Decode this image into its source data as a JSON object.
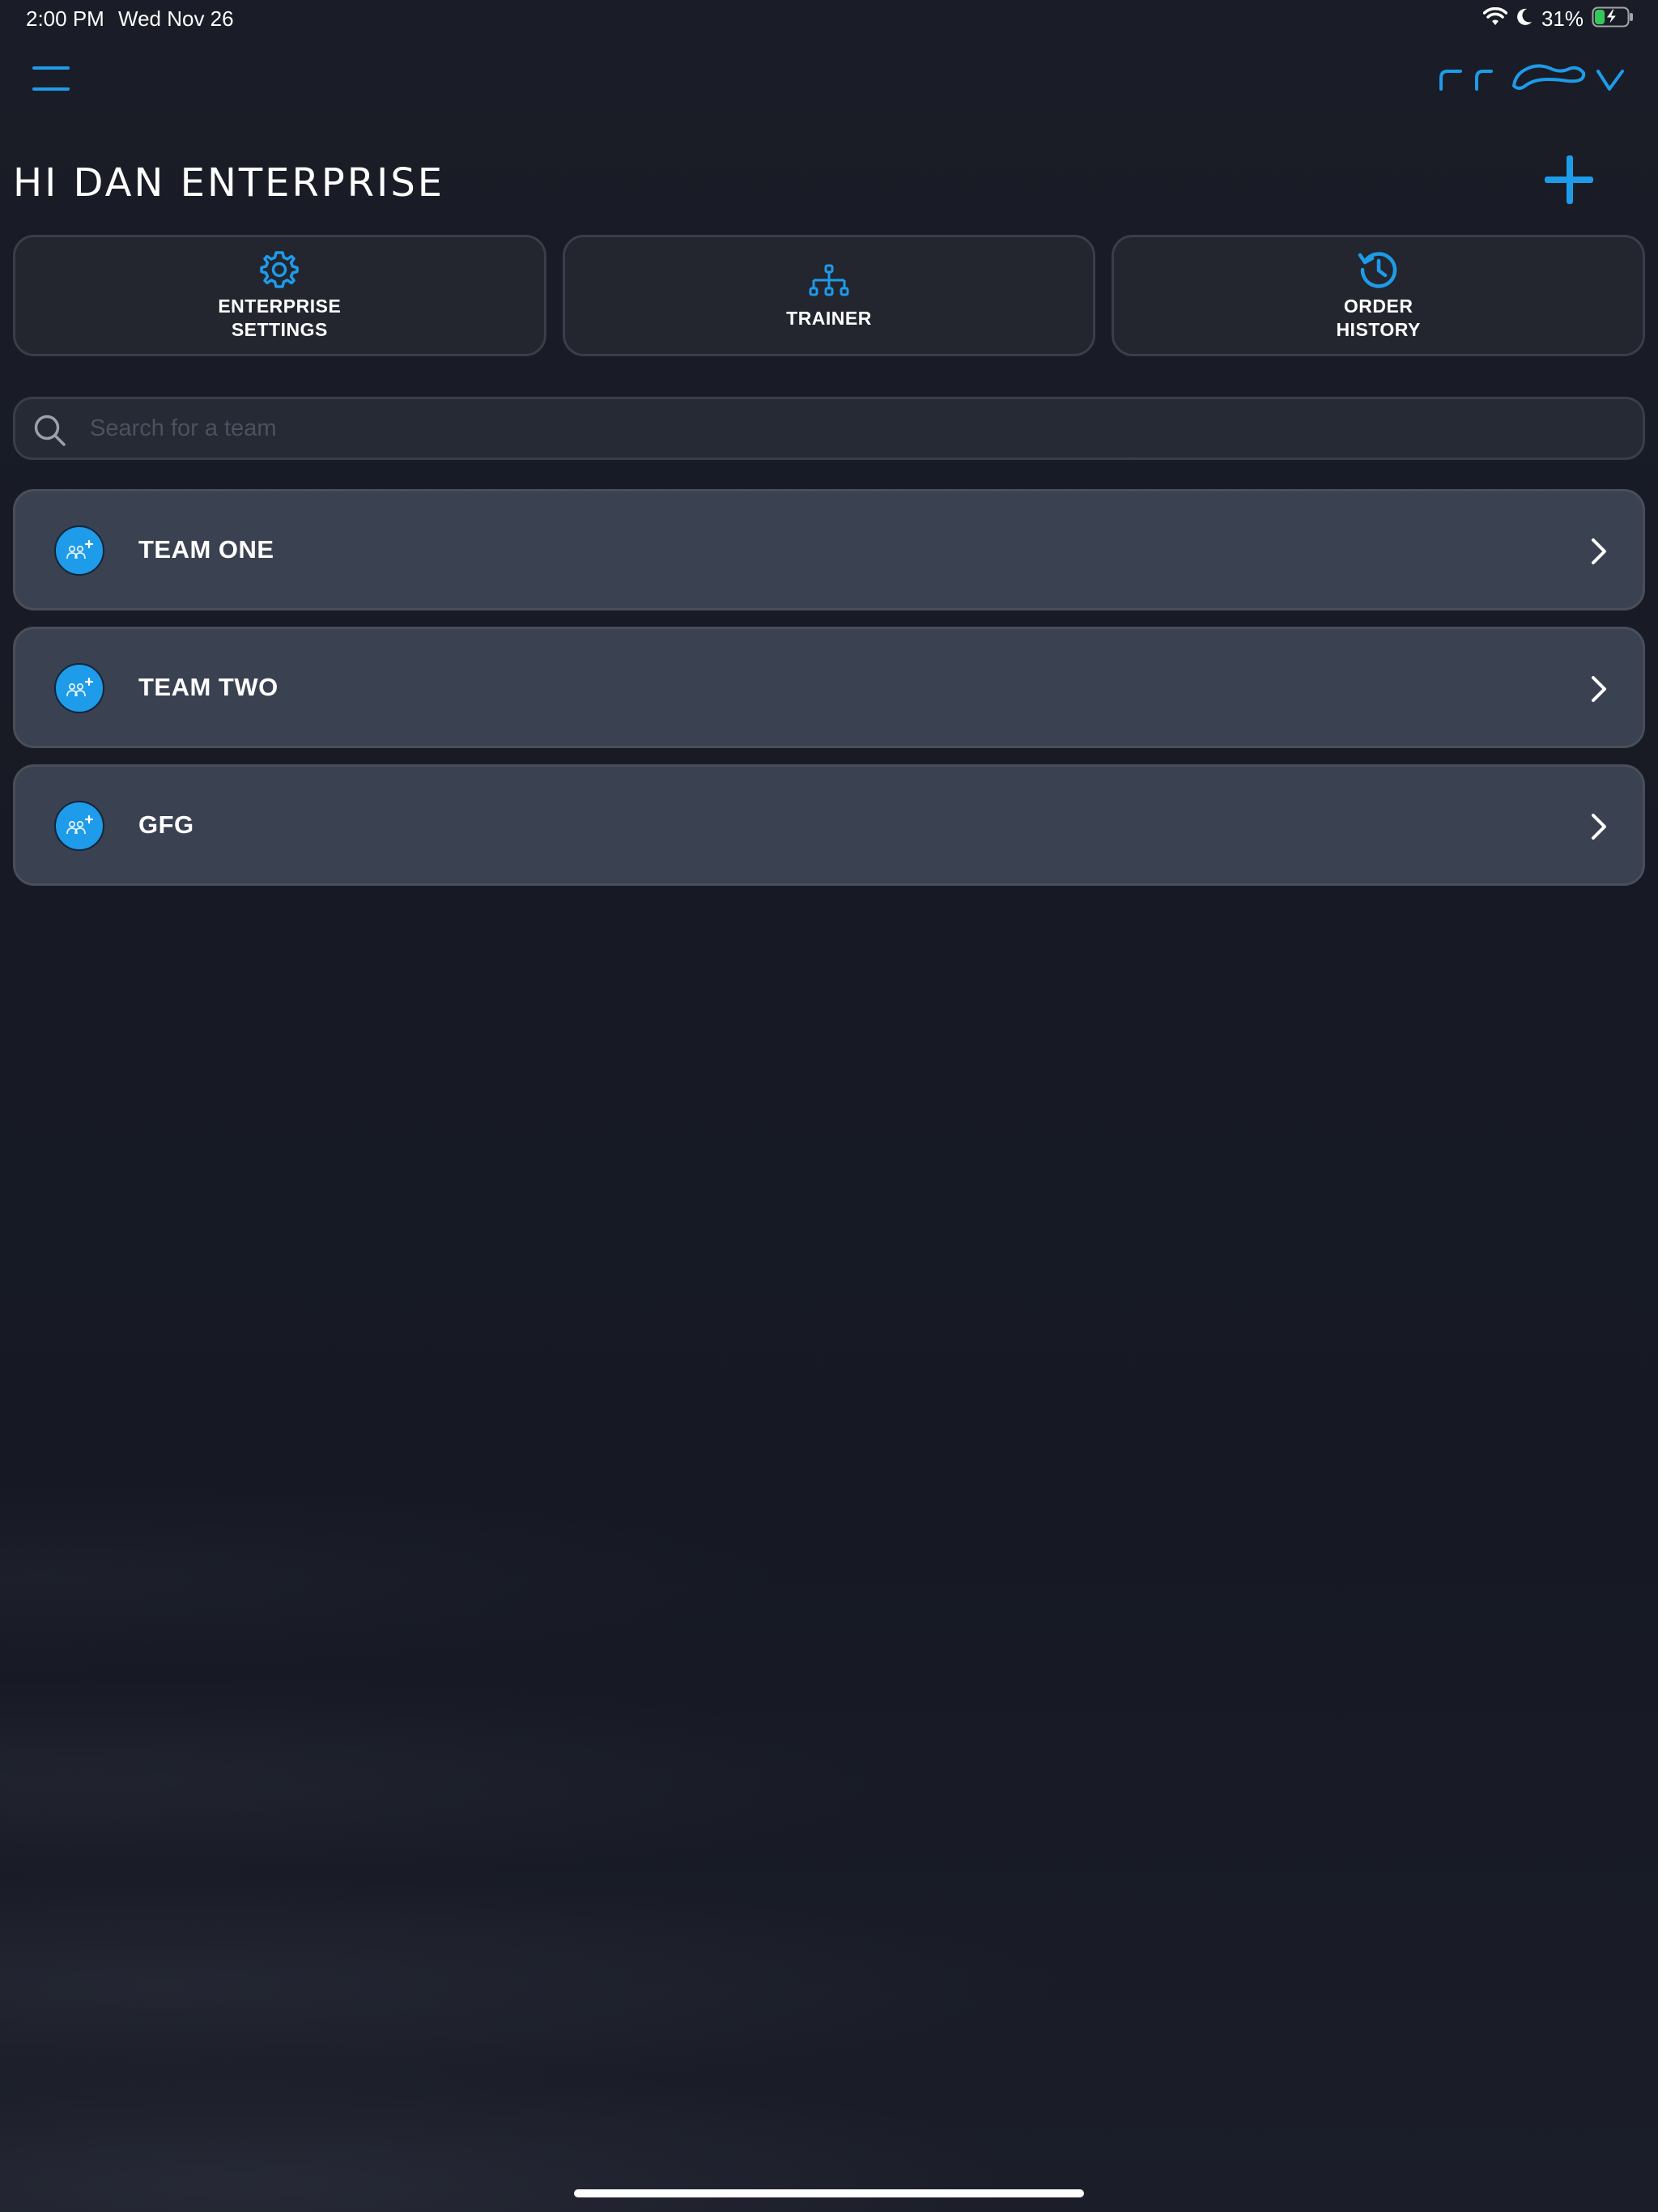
{
  "status_bar": {
    "time": "2:00 PM",
    "date": "Wed Nov 26",
    "battery_percent": "31%",
    "battery_level": 0.31
  },
  "header": {
    "logo_text": "grov",
    "greeting": "HI DAN ENTERPRISE"
  },
  "actions": [
    {
      "label": "ENTERPRISE\nSETTINGS",
      "icon": "gear-icon"
    },
    {
      "label": "TRAINER",
      "icon": "org-chart-icon"
    },
    {
      "label": "ORDER\nHISTORY",
      "icon": "history-icon"
    }
  ],
  "search": {
    "placeholder": "Search for a team",
    "value": ""
  },
  "teams": [
    {
      "name": "TEAM ONE",
      "icon": "team-add-icon"
    },
    {
      "name": "TEAM TWO",
      "icon": "team-add-icon"
    },
    {
      "name": "GFG",
      "icon": "team-add-icon"
    }
  ],
  "colors": {
    "accent": "#1e9be9",
    "background": "#171a24",
    "card": "#23262f",
    "team_row": "#3a4150"
  }
}
